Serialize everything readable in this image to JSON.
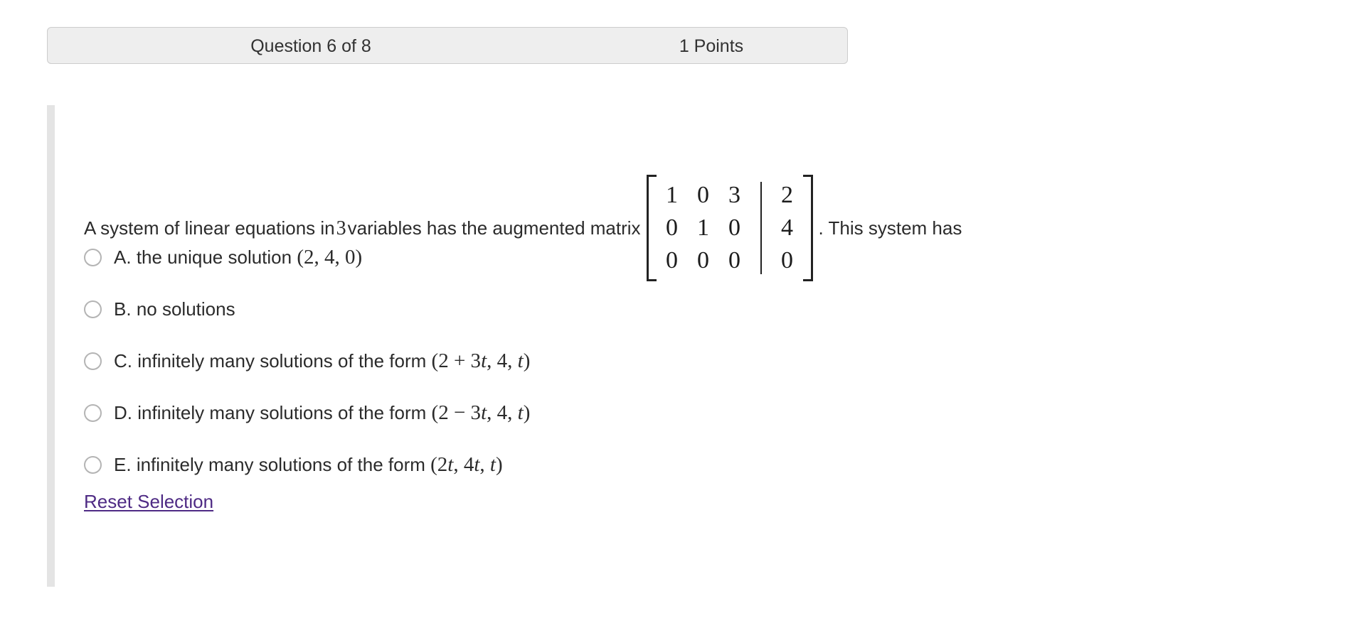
{
  "header": {
    "question_counter": "Question 6 of 8",
    "points": "1 Points"
  },
  "question": {
    "text_before_matrix": "A system of linear equations in",
    "variable_count": "3",
    "text_after_count": "variables has the augmented matrix",
    "text_after_matrix": ". This system has",
    "matrix": {
      "coefficients": [
        [
          "1",
          "0",
          "3"
        ],
        [
          "0",
          "1",
          "0"
        ],
        [
          "0",
          "0",
          "0"
        ]
      ],
      "constants": [
        "2",
        "4",
        "0"
      ],
      "augmented_divider": true,
      "bracket_style": "square"
    }
  },
  "options": [
    {
      "letter": "A.",
      "text": "the unique solution",
      "math": "(2, 4, 0)",
      "selected": false
    },
    {
      "letter": "B.",
      "text": "no solutions",
      "math": "",
      "selected": false
    },
    {
      "letter": "C.",
      "text": "infinitely many solutions of the form",
      "math": "(2 + 3t, 4, t)",
      "selected": false
    },
    {
      "letter": "D.",
      "text": "infinitely many solutions of the form",
      "math": "(2 − 3t, 4, t)",
      "selected": false
    },
    {
      "letter": "E.",
      "text": "infinitely many solutions of the form",
      "math": "(2t, 4t, t)",
      "selected": false
    }
  ],
  "reset": {
    "label": "Reset Selection"
  },
  "colors": {
    "link": "#4e2a84",
    "header_bg": "#eeeeee",
    "header_border": "#cccccc",
    "rail": "#e4e4e4",
    "radio_border": "#b4b4b4",
    "text": "#2b2b2b"
  }
}
